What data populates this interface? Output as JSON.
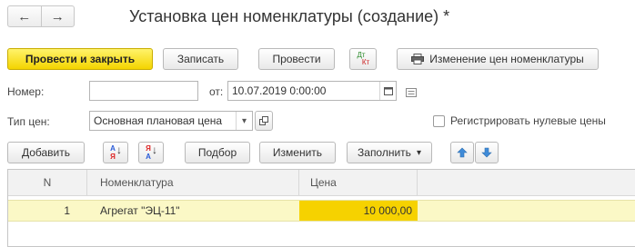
{
  "nav": {
    "back_icon": "arrow-left-icon",
    "forward_icon": "arrow-right-icon",
    "back_glyph": "←",
    "forward_glyph": "→"
  },
  "window": {
    "title": "Установка цен номенклатуры (создание) *"
  },
  "toolbar": {
    "post_and_close": "Провести и закрыть",
    "save": "Записать",
    "post": "Провести",
    "dtkt_top": "Дт",
    "dtkt_bottom": "Кт",
    "print_change": "Изменение цен номенклатуры"
  },
  "header": {
    "number_label": "Номер:",
    "number_value": "",
    "from_label": "от:",
    "date_value": "10.07.2019  0:00:00",
    "price_type_label": "Тип цен:",
    "price_type_value": "Основная плановая цена",
    "register_zero_label": "Регистрировать нулевые цены",
    "register_zero_checked": false
  },
  "table_toolbar": {
    "add": "Добавить",
    "sort_asc_top": "А",
    "sort_asc_bottom": "Я",
    "sort_desc_top": "Я",
    "sort_desc_bottom": "А",
    "pick": "Подбор",
    "change": "Изменить",
    "fill": "Заполнить",
    "fill_arrow": "▾",
    "up_glyph": "🡅",
    "down_glyph": "🡇"
  },
  "table": {
    "columns": [
      "N",
      "Номенклатура",
      "Цена"
    ],
    "rows": [
      {
        "n": "1",
        "item": "Агрегат \"ЭЦ-11\"",
        "price": "10 000,00"
      }
    ]
  },
  "colors": {
    "primary": "#f4d400",
    "row_highlight": "#fbf8c6",
    "price_cell": "#f6d200",
    "arrow_blue": "#3f8bd8"
  }
}
